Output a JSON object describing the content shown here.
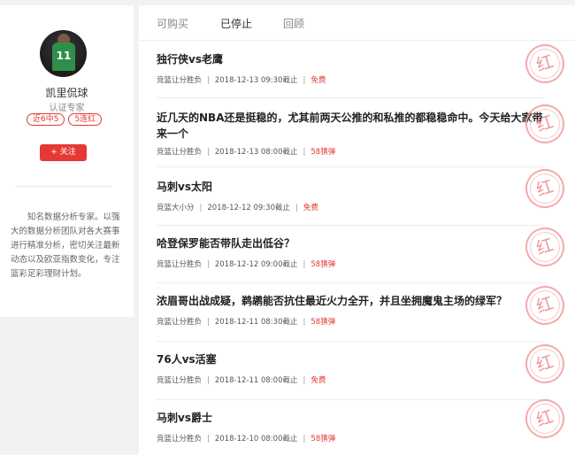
{
  "expert": {
    "name": "凯里侃球",
    "title": "认证专家",
    "avatar_number": "11",
    "tags": [
      "近6中5",
      "5连红"
    ],
    "follow_label": "+ 关注",
    "description": "知名数据分析专家。以强大的数据分析团队对各大赛事进行精准分析，密切关注最新动态以及欧亚指数变化，专注篮彩足彩理财计划。"
  },
  "tabs": [
    {
      "label": "可购买",
      "active": false
    },
    {
      "label": "已停止",
      "active": true
    },
    {
      "label": "回顾",
      "active": false
    }
  ],
  "stamp_text": "红",
  "articles": [
    {
      "title": "独行侠vs老鹰",
      "type": "竞篮让分胜负",
      "time": "2018-12-13 09:30截止",
      "price": "免费"
    },
    {
      "title": "近几天的NBA还是挺稳的，尤其前两天公推的和私推的都稳稳命中。今天给大家带来一个",
      "type": "竞篮让分胜负",
      "time": "2018-12-13 08:00截止",
      "price": "58猜弹"
    },
    {
      "title": "马刺vs太阳",
      "type": "竞篮大小分",
      "time": "2018-12-12 09:30截止",
      "price": "免费"
    },
    {
      "title": "哈登保罗能否带队走出低谷？",
      "type": "竞篮让分胜负",
      "time": "2018-12-12 09:00截止",
      "price": "58猜弹"
    },
    {
      "title": "浓眉哥出战成疑，鹈鹕能否抗住最近火力全开，并且坐拥魔鬼主场的绿军？",
      "type": "竞篮让分胜负",
      "time": "2018-12-11 08:30截止",
      "price": "58猜弹"
    },
    {
      "title": "76人vs活塞",
      "type": "竞篮让分胜负",
      "time": "2018-12-11 08:00截止",
      "price": "免费"
    },
    {
      "title": "马刺vs爵士",
      "type": "竞篮让分胜负",
      "time": "2018-12-10 08:00截止",
      "price": "58猜弹"
    }
  ]
}
